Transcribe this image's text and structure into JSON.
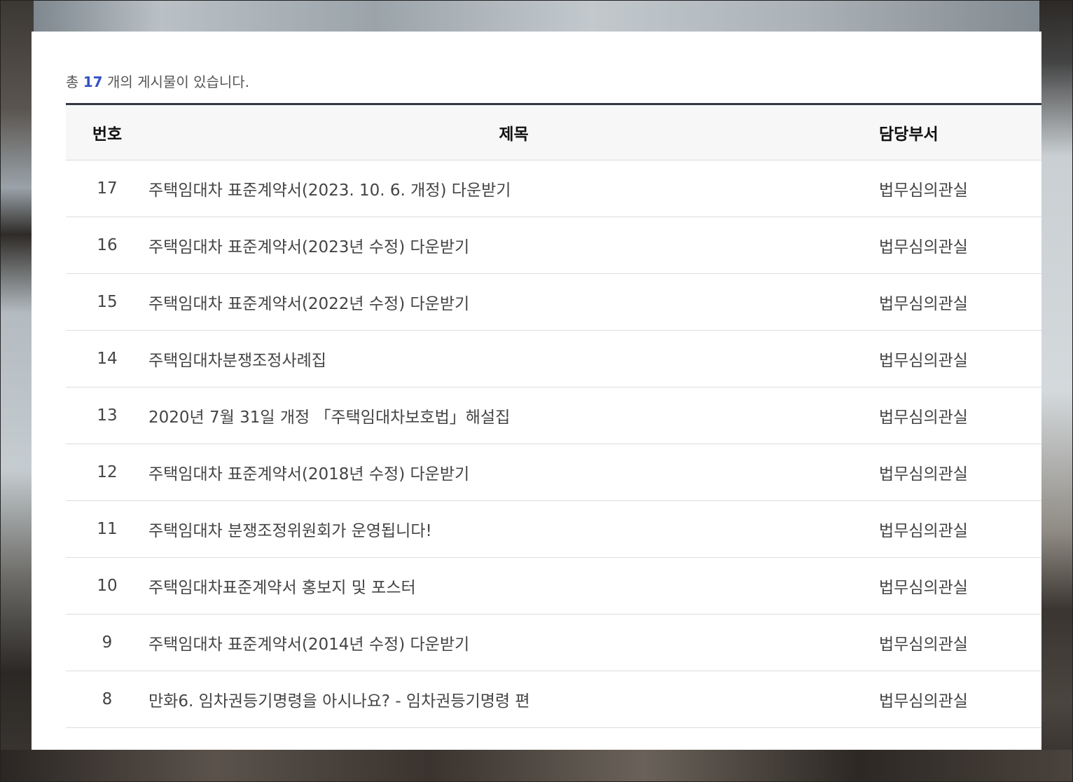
{
  "summary": {
    "prefix": "총",
    "count": "17",
    "suffix": "개의 게시물이 있습니다."
  },
  "table": {
    "headers": {
      "no": "번호",
      "title": "제목",
      "dept": "담당부서"
    },
    "rows": [
      {
        "no": "17",
        "title": "주택임대차 표준계약서(2023. 10. 6. 개정) 다운받기",
        "dept": "법무심의관실"
      },
      {
        "no": "16",
        "title": "주택임대차 표준계약서(2023년 수정) 다운받기",
        "dept": "법무심의관실"
      },
      {
        "no": "15",
        "title": "주택임대차 표준계약서(2022년 수정) 다운받기",
        "dept": "법무심의관실"
      },
      {
        "no": "14",
        "title": "주택임대차분쟁조정사례집",
        "dept": "법무심의관실"
      },
      {
        "no": "13",
        "title": "2020년 7월 31일 개정 「주택임대차보호법」해설집",
        "dept": "법무심의관실"
      },
      {
        "no": "12",
        "title": "주택임대차 표준계약서(2018년 수정) 다운받기",
        "dept": "법무심의관실"
      },
      {
        "no": "11",
        "title": "주택임대차 분쟁조정위원회가 운영됩니다!",
        "dept": "법무심의관실"
      },
      {
        "no": "10",
        "title": "주택임대차표준계약서 홍보지 및 포스터",
        "dept": "법무심의관실"
      },
      {
        "no": "9",
        "title": "주택임대차 표준계약서(2014년 수정) 다운받기",
        "dept": "법무심의관실"
      },
      {
        "no": "8",
        "title": "만화6. 임차권등기명령을 아시나요? - 임차권등기명령 편",
        "dept": "법무심의관실"
      }
    ]
  },
  "colors": {
    "accent": "#3553c5",
    "header_border": "#333843",
    "header_bg": "#f7f7f7"
  }
}
